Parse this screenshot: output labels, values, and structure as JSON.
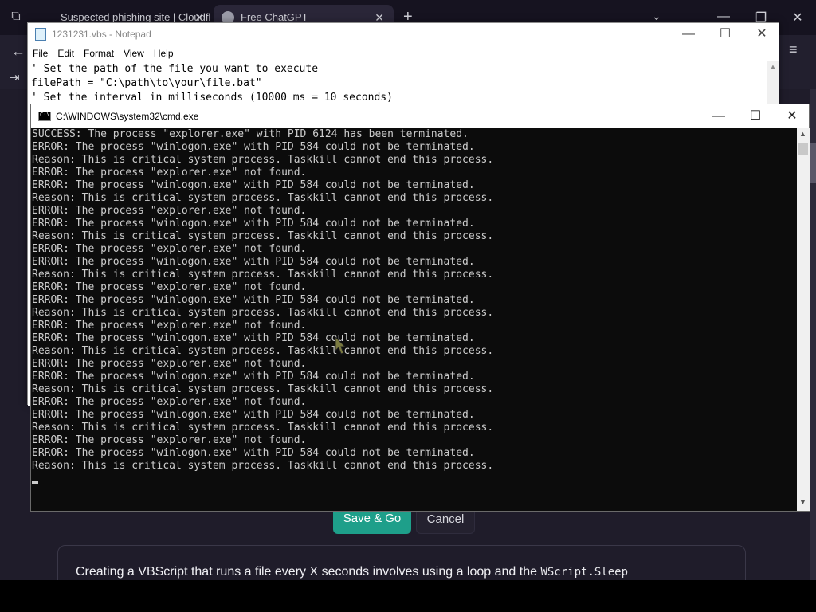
{
  "browser": {
    "tabs": [
      {
        "label": "Suspected phishing site | Cloudfl"
      },
      {
        "label": "Free ChatGPT"
      }
    ],
    "new_tab": "+",
    "tab_dropdown": "⌄",
    "controls": {
      "minimize": "—",
      "restore": "❐",
      "close": "✕"
    },
    "nav": {
      "back": "←",
      "login": "⇥",
      "menu": "≡"
    },
    "buttons": {
      "save_go": "Save & Go",
      "cancel": "Cancel"
    },
    "answer": {
      "text_before": "Creating a VBScript that runs a file every X seconds involves using a loop and the ",
      "code": "WScript.Sleep"
    }
  },
  "notepad": {
    "title": "1231231.vbs - Notepad",
    "controls": {
      "minimize": "—",
      "maximize": "☐",
      "close": "✕"
    },
    "menu": [
      "File",
      "Edit",
      "Format",
      "View",
      "Help"
    ],
    "lines": [
      "' Set the path of the file you want to execute",
      "filePath = \"C:\\path\\to\\your\\file.bat\"",
      "' Set the interval in milliseconds (10000 ms = 10 seconds)"
    ]
  },
  "cmd": {
    "title": "C:\\WINDOWS\\system32\\cmd.exe",
    "controls": {
      "minimize": "—",
      "maximize": "☐",
      "close": "✕"
    },
    "lines": [
      "SUCCESS: The process \"explorer.exe\" with PID 6124 has been terminated.",
      "ERROR: The process \"winlogon.exe\" with PID 584 could not be terminated.",
      "Reason: This is critical system process. Taskkill cannot end this process.",
      "ERROR: The process \"explorer.exe\" not found.",
      "ERROR: The process \"winlogon.exe\" with PID 584 could not be terminated.",
      "Reason: This is critical system process. Taskkill cannot end this process.",
      "ERROR: The process \"explorer.exe\" not found.",
      "ERROR: The process \"winlogon.exe\" with PID 584 could not be terminated.",
      "Reason: This is critical system process. Taskkill cannot end this process.",
      "ERROR: The process \"explorer.exe\" not found.",
      "ERROR: The process \"winlogon.exe\" with PID 584 could not be terminated.",
      "Reason: This is critical system process. Taskkill cannot end this process.",
      "ERROR: The process \"explorer.exe\" not found.",
      "ERROR: The process \"winlogon.exe\" with PID 584 could not be terminated.",
      "Reason: This is critical system process. Taskkill cannot end this process.",
      "ERROR: The process \"explorer.exe\" not found.",
      "ERROR: The process \"winlogon.exe\" with PID 584 could not be terminated.",
      "Reason: This is critical system process. Taskkill cannot end this process.",
      "ERROR: The process \"explorer.exe\" not found.",
      "ERROR: The process \"winlogon.exe\" with PID 584 could not be terminated.",
      "Reason: This is critical system process. Taskkill cannot end this process.",
      "ERROR: The process \"explorer.exe\" not found.",
      "ERROR: The process \"winlogon.exe\" with PID 584 could not be terminated.",
      "Reason: This is critical system process. Taskkill cannot end this process.",
      "ERROR: The process \"explorer.exe\" not found.",
      "ERROR: The process \"winlogon.exe\" with PID 584 could not be terminated.",
      "Reason: This is critical system process. Taskkill cannot end this process."
    ]
  },
  "colors": {
    "accent": "#1e9f8a",
    "console_bg": "#0c0c0c",
    "console_text": "#cccccc",
    "browser_bg": "#1f1c2a"
  }
}
